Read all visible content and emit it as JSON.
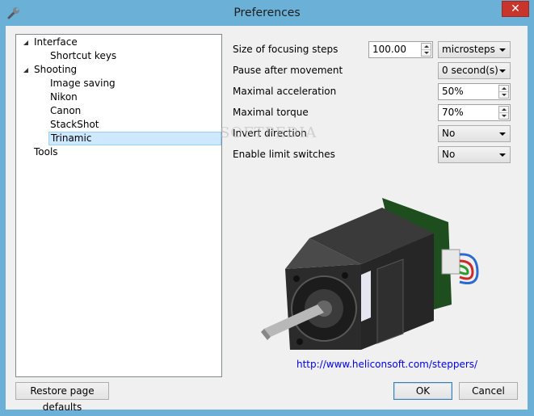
{
  "window": {
    "title": "Preferences",
    "close_glyph": "✕"
  },
  "tree": {
    "items": [
      {
        "label": "Interface",
        "level": 0,
        "expanded": true
      },
      {
        "label": "Shortcut keys",
        "level": 1
      },
      {
        "label": "Shooting",
        "level": 0,
        "expanded": true
      },
      {
        "label": "Image saving",
        "level": 1
      },
      {
        "label": "Nikon",
        "level": 1
      },
      {
        "label": "Canon",
        "level": 1
      },
      {
        "label": "StackShot",
        "level": 1
      },
      {
        "label": "Trinamic",
        "level": 1,
        "selected": true
      },
      {
        "label": "Tools",
        "level": 0
      }
    ]
  },
  "settings": {
    "focusing_steps": {
      "label": "Size of focusing steps",
      "value": "100.00",
      "unit": "microsteps"
    },
    "pause": {
      "label": "Pause after movement",
      "value": "0  second(s)"
    },
    "acceleration": {
      "label": "Maximal acceleration",
      "value": "50%"
    },
    "torque": {
      "label": "Maximal torque",
      "value": "70%"
    },
    "invert": {
      "label": "Invert direction",
      "value": "No"
    },
    "limit_switches": {
      "label": "Enable limit switches",
      "value": "No"
    }
  },
  "link": {
    "text": "http://www.heliconsoft.com/steppers/"
  },
  "watermark": {
    "text": "SOFTPEDIA"
  },
  "buttons": {
    "restore": "Restore page defaults",
    "ok": "OK",
    "cancel": "Cancel"
  },
  "colors": {
    "titlebar": "#6bb0d6",
    "close": "#c7352b",
    "selection": "#cde8ff",
    "link": "#0000ee"
  }
}
